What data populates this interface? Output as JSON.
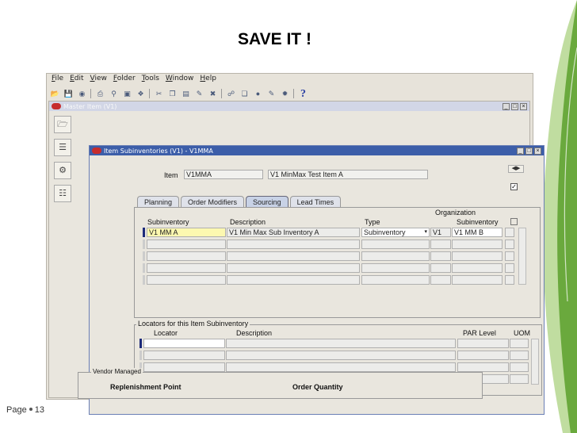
{
  "slide": {
    "title": "SAVE IT !",
    "footer_label": "Page",
    "footer_number": "13"
  },
  "menu": [
    "File",
    "Edit",
    "View",
    "Folder",
    "Tools",
    "Window",
    "Help"
  ],
  "toolbar_icons": [
    "open-icon",
    "save-icon",
    "navigator-icon",
    "zoom-icon",
    "print-icon",
    "find-icon",
    "folder-icon",
    "attachments-icon",
    "cut-icon",
    "copy-icon",
    "paste-icon",
    "clear-icon",
    "delete-icon",
    "edit-icon",
    "new-record-icon",
    "translate-icon",
    "attachment-icon",
    "folder-tools-icon",
    "help-icon"
  ],
  "help_glyph": "?",
  "master_window": {
    "title": "Master Item (V1)"
  },
  "sub_window": {
    "title": "Item Subinventories (V1) - V1MMA",
    "item_label": "Item",
    "item_value": "V1MMA",
    "item_description": "V1 MinMax Test Item A",
    "checkbox_checked": true,
    "tabs": [
      {
        "label": "Planning",
        "active": false
      },
      {
        "label": "Order Modifiers",
        "active": false
      },
      {
        "label": "Sourcing",
        "active": true
      },
      {
        "label": "Lead Times",
        "active": false
      }
    ],
    "grid": {
      "header_org": "Organization",
      "col_subinventory": "Subinventory",
      "col_description": "Description",
      "col_type": "Type",
      "col_org_subinventory": "Subinventory",
      "rows": [
        {
          "subinventory": "V1 MM A",
          "description": "V1 Min Max Sub Inventory A",
          "type": "Subinventory",
          "org": "V1",
          "org_subinventory": "V1 MM B"
        }
      ]
    },
    "locators": {
      "section_title": "Locators for this Item Subinventory",
      "col_locator": "Locator",
      "col_description": "Description",
      "col_par_level": "PAR Level",
      "col_uom": "UOM"
    },
    "vendor": {
      "section_title": "Vendor Managed",
      "replenishment_point": "Replenishment Point",
      "order_quantity": "Order Quantity"
    }
  }
}
